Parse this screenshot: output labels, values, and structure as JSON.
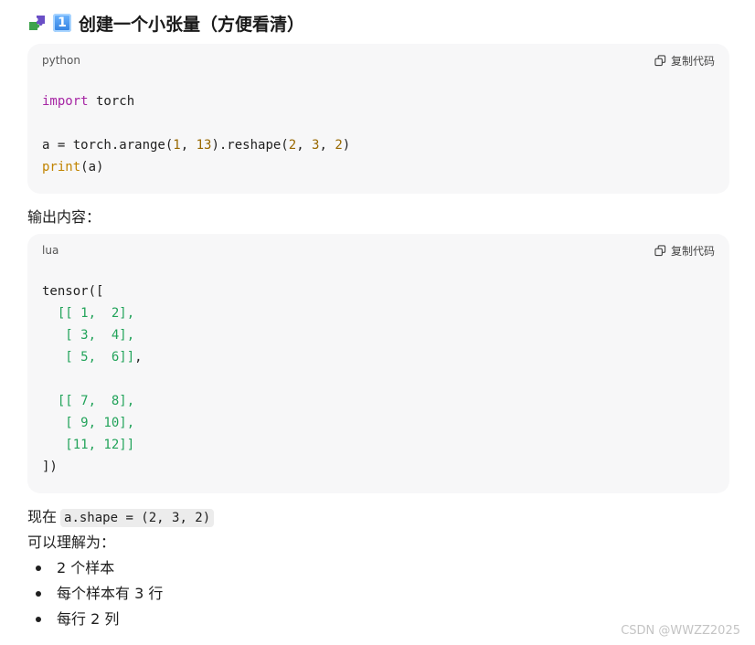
{
  "heading": {
    "icon": "puzzle-piece-icon",
    "keycap": "1",
    "text": "创建一个小张量（方便看清）"
  },
  "code_block_1": {
    "language": "python",
    "copy_label": "复制代码",
    "lines": {
      "l1_kw": "import",
      "l1_rest": " torch",
      "l3_a": "a = torch.arange(",
      "l3_n1": "1",
      "l3_b": ", ",
      "l3_n2": "13",
      "l3_c": ").reshape(",
      "l3_n3": "2",
      "l3_d": ", ",
      "l3_n4": "3",
      "l3_e": ", ",
      "l3_n5": "2",
      "l3_f": ")",
      "l4_fn": "print",
      "l4_rest": "(a)"
    }
  },
  "output_label": "输出内容：",
  "code_block_2": {
    "language": "lua",
    "copy_label": "复制代码",
    "lines": {
      "l1": "tensor([",
      "l2": "  [[ 1,  2],",
      "l3": "   [ 3,  4],",
      "l4_g": "   [ 5,  6]]",
      "l4_c": ",",
      "l6": "  [[ 7,  8],",
      "l7": "   [ 9, 10],",
      "l8": "   [11, 12]]",
      "l9": "])"
    }
  },
  "shape_line": {
    "prefix": "现在",
    "code": "a.shape = (2, 3, 2)"
  },
  "understand_label": "可以理解为：",
  "bullets": [
    "2 个样本",
    "每个样本有 3 行",
    "每行 2 列"
  ],
  "watermark": "CSDN @WWZZ2025"
}
